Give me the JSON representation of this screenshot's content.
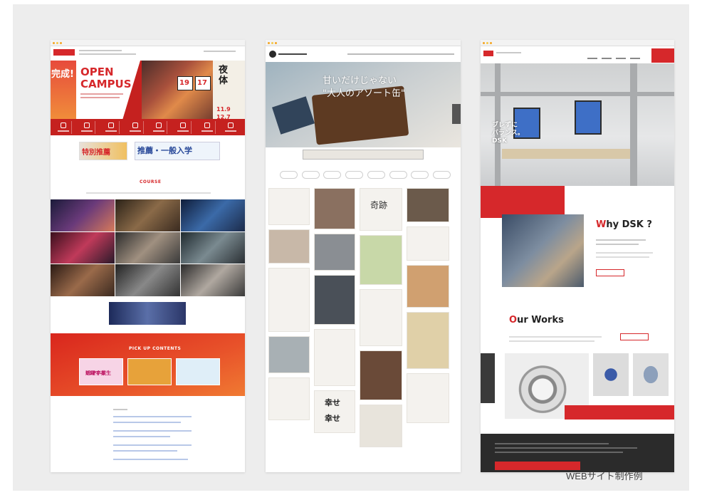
{
  "caption": "WEBサイト制作例",
  "site1": {
    "hero_left_word": "完成!",
    "hero_title_line1": "OPEN",
    "hero_title_line2": "CAMPUS",
    "date1": "19",
    "date2": "17",
    "right_title_line1": "夜",
    "right_title_line2": "体",
    "right_dates": "11.9\n12.7",
    "banner_left": "特別推薦",
    "banner_right": "推薦・一般入学",
    "course_heading": "COURSE",
    "pickup_heading": "PICK UP CONTENTS",
    "pickup_card1_line1": "活躍する",
    "pickup_card1_line2": "ESP卒業生"
  },
  "site2": {
    "hero_line1": "甘いだけじゃない",
    "hero_line2": "\"大人のアソート缶\"",
    "tile_kiseki": "奇跡",
    "tile_shiawase1": "幸せ",
    "tile_shiawase2": "幸せ"
  },
  "site3": {
    "hero_line1": "ブレずに",
    "hero_line2": "バランス。",
    "hero_line3": "DSK",
    "why_red": "W",
    "why_rest": "hy DSK ?",
    "works_red": "O",
    "works_rest": "ur Works"
  },
  "colors": {
    "brand_red": "#d6282b",
    "frame_gray": "#ededed",
    "dark_footer": "#2b2b2b"
  }
}
